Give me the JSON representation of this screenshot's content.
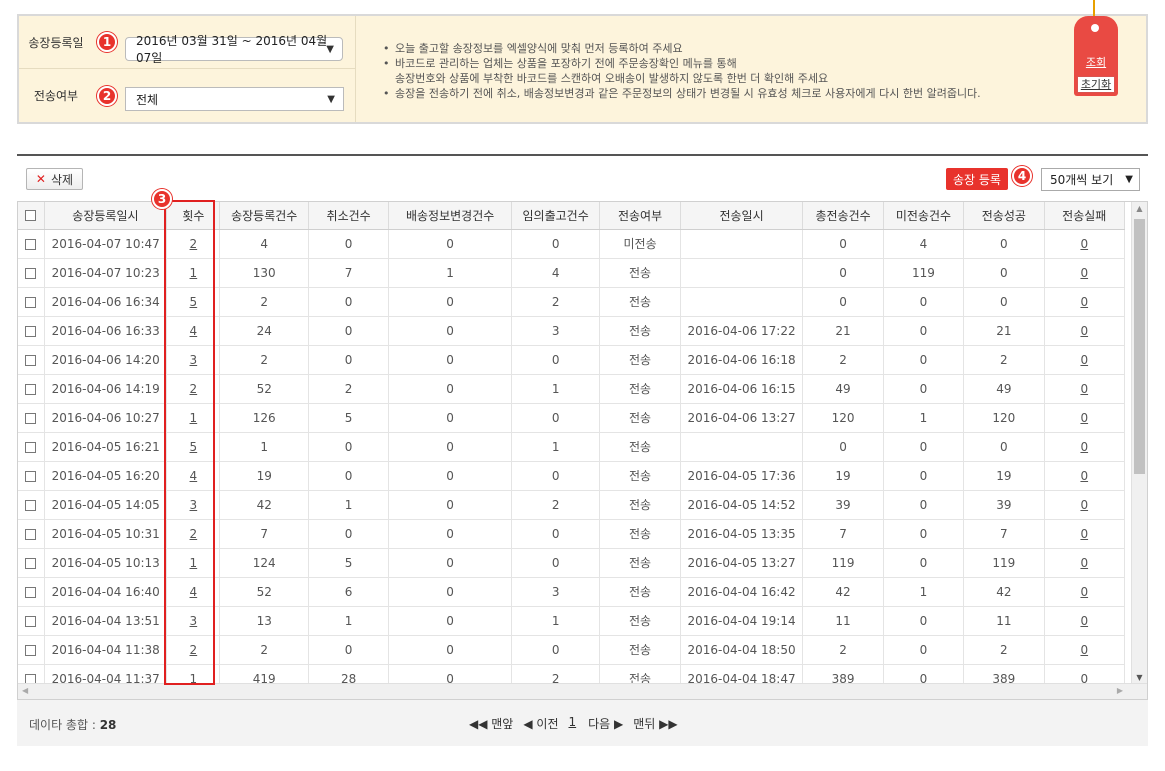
{
  "filter": {
    "date_label": "송장등록일",
    "date_value": "2016년 03월 31일 ~ 2016년 04월 07일",
    "send_label": "전송여부",
    "send_value": "전체",
    "notes": [
      "오늘 출고할 송장정보를 엑셀양식에 맞춰 먼저 등록하여 주세요",
      "바코드로 관리하는 업체는 상품을 포장하기 전에 주문송장확인 메뉴를 통해",
      "송장번호와 상품에 부착한 바코드를 스캔하여 오배송이 발생하지 않도록 한번 더 확인해 주세요",
      "송장을 전송하기 전에 취소, 배송정보변경과 같은 주문정보의 상태가 변경될 시 유효성 체크로 사용자에게 다시 한번 알려줍니다."
    ],
    "search_label": "조회",
    "reset_label": "초기화"
  },
  "badges": [
    "1",
    "2",
    "3",
    "4"
  ],
  "toolbar": {
    "delete_label": "삭제",
    "register_label": "송장 등록",
    "perpage_value": "50개씩 보기"
  },
  "table": {
    "headers": [
      "송장등록일시",
      "횟수",
      "송장등록건수",
      "취소건수",
      "배송정보변경건수",
      "임의출고건수",
      "전송여부",
      "전송일시",
      "총전송건수",
      "미전송건수",
      "전송성공",
      "전송실패"
    ],
    "rows": [
      [
        "2016-04-07 10:47",
        "2",
        "4",
        "0",
        "0",
        "0",
        "미전송",
        "",
        "0",
        "4",
        "0",
        "0"
      ],
      [
        "2016-04-07 10:23",
        "1",
        "130",
        "7",
        "1",
        "4",
        "전송",
        "",
        "0",
        "119",
        "0",
        "0"
      ],
      [
        "2016-04-06 16:34",
        "5",
        "2",
        "0",
        "0",
        "2",
        "전송",
        "",
        "0",
        "0",
        "0",
        "0"
      ],
      [
        "2016-04-06 16:33",
        "4",
        "24",
        "0",
        "0",
        "3",
        "전송",
        "2016-04-06 17:22",
        "21",
        "0",
        "21",
        "0"
      ],
      [
        "2016-04-06 14:20",
        "3",
        "2",
        "0",
        "0",
        "0",
        "전송",
        "2016-04-06 16:18",
        "2",
        "0",
        "2",
        "0"
      ],
      [
        "2016-04-06 14:19",
        "2",
        "52",
        "2",
        "0",
        "1",
        "전송",
        "2016-04-06 16:15",
        "49",
        "0",
        "49",
        "0"
      ],
      [
        "2016-04-06 10:27",
        "1",
        "126",
        "5",
        "0",
        "0",
        "전송",
        "2016-04-06 13:27",
        "120",
        "1",
        "120",
        "0"
      ],
      [
        "2016-04-05 16:21",
        "5",
        "1",
        "0",
        "0",
        "1",
        "전송",
        "",
        "0",
        "0",
        "0",
        "0"
      ],
      [
        "2016-04-05 16:20",
        "4",
        "19",
        "0",
        "0",
        "0",
        "전송",
        "2016-04-05 17:36",
        "19",
        "0",
        "19",
        "0"
      ],
      [
        "2016-04-05 14:05",
        "3",
        "42",
        "1",
        "0",
        "2",
        "전송",
        "2016-04-05 14:52",
        "39",
        "0",
        "39",
        "0"
      ],
      [
        "2016-04-05 10:31",
        "2",
        "7",
        "0",
        "0",
        "0",
        "전송",
        "2016-04-05 13:35",
        "7",
        "0",
        "7",
        "0"
      ],
      [
        "2016-04-05 10:13",
        "1",
        "124",
        "5",
        "0",
        "0",
        "전송",
        "2016-04-05 13:27",
        "119",
        "0",
        "119",
        "0"
      ],
      [
        "2016-04-04 16:40",
        "4",
        "52",
        "6",
        "0",
        "3",
        "전송",
        "2016-04-04 16:42",
        "42",
        "1",
        "42",
        "0"
      ],
      [
        "2016-04-04 13:51",
        "3",
        "13",
        "1",
        "0",
        "1",
        "전송",
        "2016-04-04 19:14",
        "11",
        "0",
        "11",
        "0"
      ],
      [
        "2016-04-04 11:38",
        "2",
        "2",
        "0",
        "0",
        "0",
        "전송",
        "2016-04-04 18:50",
        "2",
        "0",
        "2",
        "0"
      ],
      [
        "2016-04-04 11:37",
        "1",
        "419",
        "28",
        "0",
        "2",
        "전송",
        "2016-04-04 18:47",
        "389",
        "0",
        "389",
        "0"
      ]
    ]
  },
  "footer": {
    "total_label": "데이타 총합 :",
    "total_value": "28",
    "first": "◀◀ 맨앞",
    "prev": "◀ 이전",
    "page": "1",
    "next": "다음 ▶",
    "last": "맨뒤 ▶▶"
  }
}
